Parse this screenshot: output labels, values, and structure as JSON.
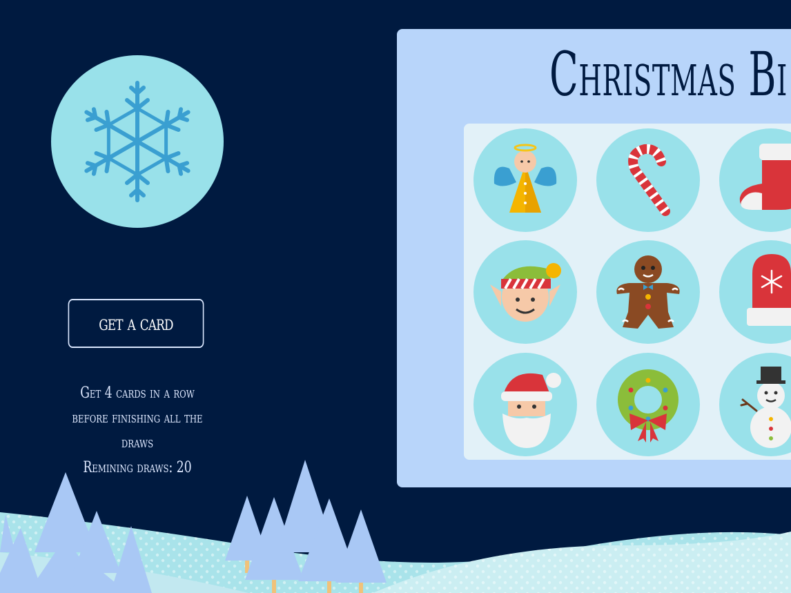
{
  "game": {
    "title": "Christmas Bi",
    "get_card_label": "get a card",
    "instructions": "Get 4 cards in a row before finishing all the draws",
    "draws_label": "Remining draws: 20"
  },
  "board": {
    "cells": [
      {
        "icon": "angel-icon"
      },
      {
        "icon": "candy-cane-icon"
      },
      {
        "icon": "stocking-icon"
      },
      {
        "icon": "elf-icon"
      },
      {
        "icon": "gingerbread-man-icon"
      },
      {
        "icon": "mitten-icon"
      },
      {
        "icon": "santa-icon"
      },
      {
        "icon": "wreath-icon"
      },
      {
        "icon": "snowman-icon"
      }
    ]
  },
  "colors": {
    "background": "#001a40",
    "board": "#b8d5fa",
    "grid": "#e2f1f8",
    "circle": "#99e1ea",
    "snowflake": "#3a9fd1",
    "tree": "#a9c8f5"
  }
}
